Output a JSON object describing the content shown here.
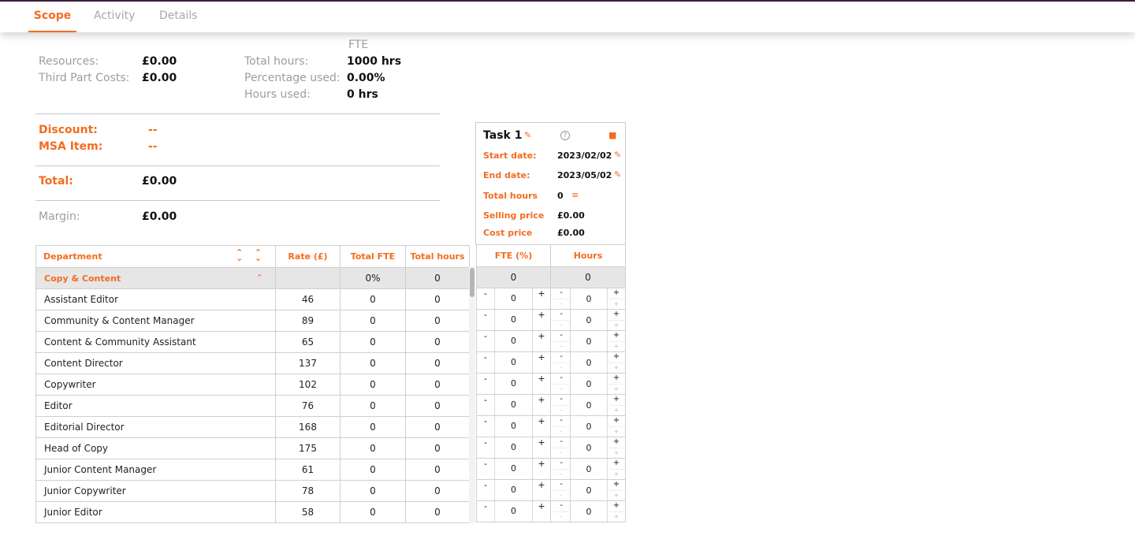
{
  "tabs": [
    {
      "label": "Scope",
      "active": true
    },
    {
      "label": "Activity",
      "active": false
    },
    {
      "label": "Details",
      "active": false
    }
  ],
  "summary": {
    "fte_header": "FTE",
    "resources_label": "Resources:",
    "resources_value": "£0.00",
    "third_party_label": "Third Part Costs:",
    "third_party_value": "£0.00",
    "total_hours_label": "Total hours:",
    "total_hours_value": "1000 hrs",
    "percentage_used_label": "Percentage used:",
    "percentage_used_value": "0.00%",
    "hours_used_label": "Hours used:",
    "hours_used_value": "0 hrs",
    "discount_label": "Discount:",
    "discount_value": "--",
    "msa_label": "MSA Item:",
    "msa_value": "--",
    "total_label": "Total:",
    "total_value": "£0.00",
    "margin_label": "Margin:",
    "margin_value": "£0.00"
  },
  "task": {
    "title": "Task 1",
    "start_label": "Start date:",
    "start_value": "2023/02/02",
    "end_label": "End date:",
    "end_value": "2023/05/02",
    "total_hours_label": "Total hours",
    "total_hours_value": "0",
    "selling_label": "Selling price",
    "selling_value": "£0.00",
    "cost_label": "Cost price",
    "cost_value": "£0.00"
  },
  "table": {
    "headers": {
      "department": "Department",
      "rate": "Rate (£)",
      "total_fte": "Total FTE",
      "total_hours": "Total hours",
      "fte_pct": "FTE (%)",
      "hours": "Hours"
    },
    "group": {
      "name": "Copy & Content",
      "total_fte": "0%",
      "total_hours": "0",
      "fte": "0",
      "hours": "0"
    },
    "rows": [
      {
        "name": "Assistant Editor",
        "rate": "46",
        "fte": "0",
        "hours": "0",
        "fte_input": "0",
        "hours_input": "0"
      },
      {
        "name": "Community & Content Manager",
        "rate": "89",
        "fte": "0",
        "hours": "0",
        "fte_input": "0",
        "hours_input": "0"
      },
      {
        "name": "Content & Community Assistant",
        "rate": "65",
        "fte": "0",
        "hours": "0",
        "fte_input": "0",
        "hours_input": "0"
      },
      {
        "name": "Content Director",
        "rate": "137",
        "fte": "0",
        "hours": "0",
        "fte_input": "0",
        "hours_input": "0"
      },
      {
        "name": "Copywriter",
        "rate": "102",
        "fte": "0",
        "hours": "0",
        "fte_input": "0",
        "hours_input": "0"
      },
      {
        "name": "Editor",
        "rate": "76",
        "fte": "0",
        "hours": "0",
        "fte_input": "0",
        "hours_input": "0"
      },
      {
        "name": "Editorial Director",
        "rate": "168",
        "fte": "0",
        "hours": "0",
        "fte_input": "0",
        "hours_input": "0"
      },
      {
        "name": "Head of Copy",
        "rate": "175",
        "fte": "0",
        "hours": "0",
        "fte_input": "0",
        "hours_input": "0"
      },
      {
        "name": "Junior Content Manager",
        "rate": "61",
        "fte": "0",
        "hours": "0",
        "fte_input": "0",
        "hours_input": "0"
      },
      {
        "name": "Junior Copywriter",
        "rate": "78",
        "fte": "0",
        "hours": "0",
        "fte_input": "0",
        "hours_input": "0"
      },
      {
        "name": "Junior Editor",
        "rate": "58",
        "fte": "0",
        "hours": "0",
        "fte_input": "0",
        "hours_input": "0"
      }
    ],
    "stepper_minus": "-",
    "stepper_plus": "+"
  },
  "colors": {
    "accent": "#f36c21",
    "top_border": "#3a1f3c",
    "group_bg": "#e6e6e6"
  }
}
